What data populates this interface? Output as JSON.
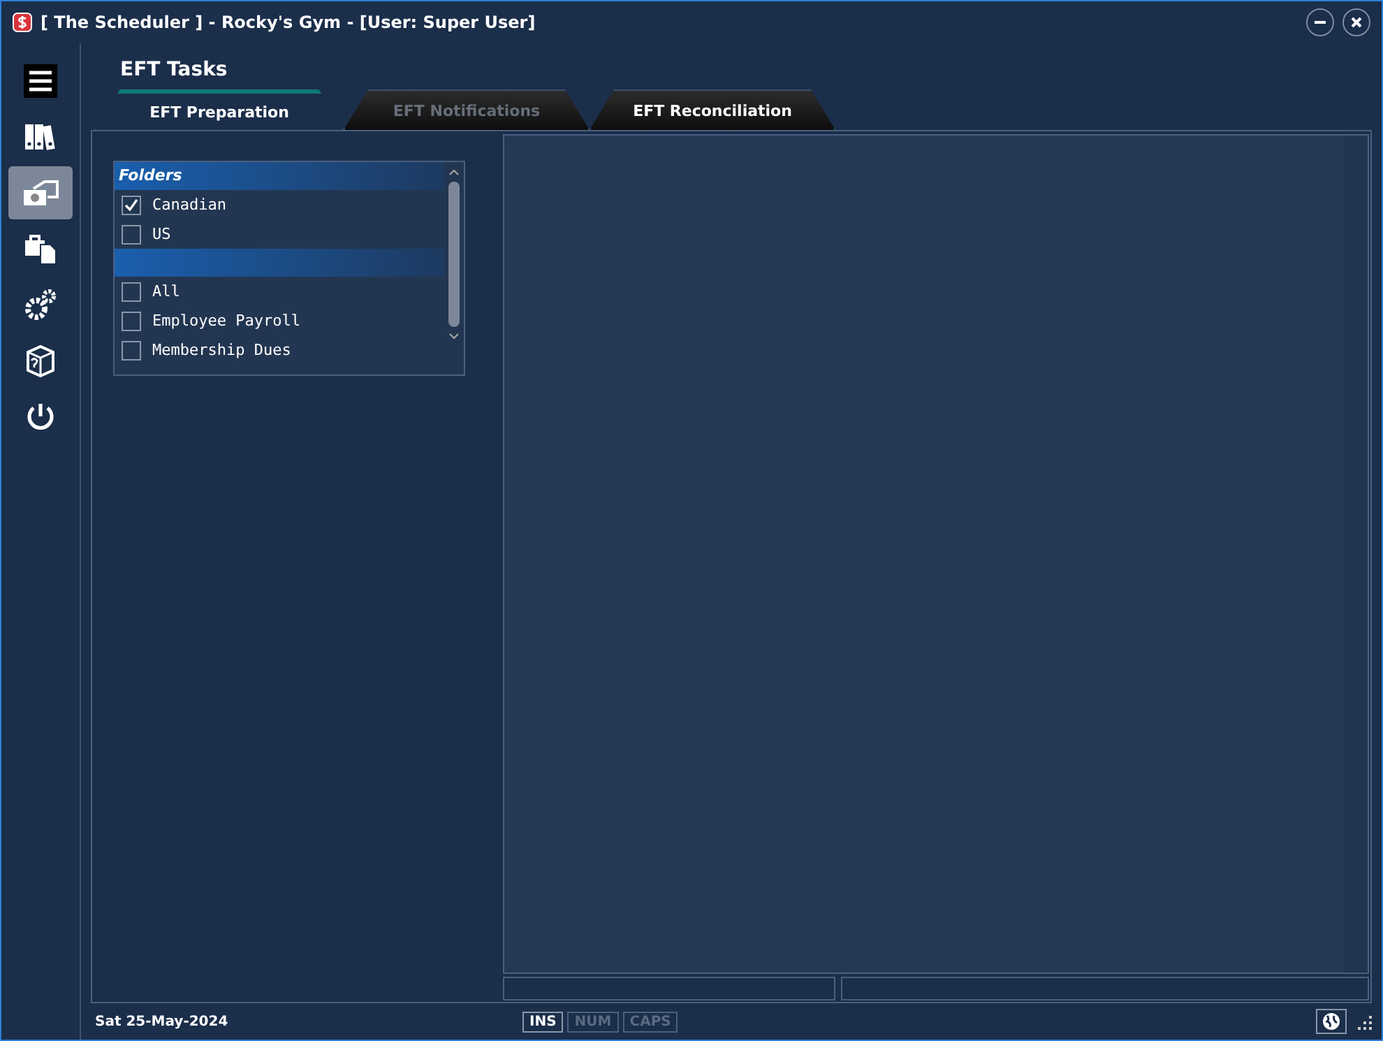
{
  "window": {
    "title": "[ The Scheduler ] - Rocky's Gym - [User: Super User]"
  },
  "sidebar": {
    "items": [
      {
        "selected": false
      },
      {
        "selected": false
      },
      {
        "selected": true
      },
      {
        "selected": false
      },
      {
        "selected": false
      },
      {
        "selected": false
      },
      {
        "selected": false
      }
    ]
  },
  "page": {
    "title": "EFT Tasks"
  },
  "tabs": [
    {
      "label": "EFT Preparation",
      "selected": true,
      "disabled": false
    },
    {
      "label": "EFT Notifications",
      "selected": false,
      "disabled": true
    },
    {
      "label": "EFT Reconciliation",
      "selected": false,
      "disabled": false
    }
  ],
  "folders": {
    "title": "Folders",
    "items": [
      {
        "kind": "check",
        "label": "Canadian",
        "checked": true
      },
      {
        "kind": "check",
        "label": "US",
        "checked": false
      },
      {
        "kind": "header"
      },
      {
        "kind": "check",
        "label": "All",
        "checked": false
      },
      {
        "kind": "check",
        "label": "Employee Payroll",
        "checked": false
      },
      {
        "kind": "check",
        "label": "Membership Dues",
        "checked": false
      }
    ]
  },
  "status_bar": {
    "date": "Sat  25-May-2024",
    "keys": [
      {
        "label": "INS",
        "on": true
      },
      {
        "label": "NUM",
        "on": false
      },
      {
        "label": "CAPS",
        "on": false
      }
    ]
  }
}
